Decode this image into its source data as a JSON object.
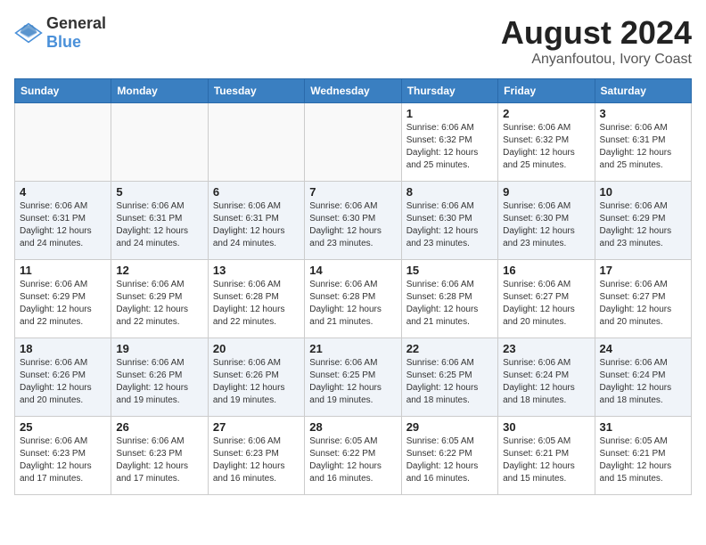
{
  "header": {
    "logo_general": "General",
    "logo_blue": "Blue",
    "title": "August 2024",
    "location": "Anyanfoutou, Ivory Coast"
  },
  "weekdays": [
    "Sunday",
    "Monday",
    "Tuesday",
    "Wednesday",
    "Thursday",
    "Friday",
    "Saturday"
  ],
  "weeks": [
    [
      {
        "day": "",
        "info": ""
      },
      {
        "day": "",
        "info": ""
      },
      {
        "day": "",
        "info": ""
      },
      {
        "day": "",
        "info": ""
      },
      {
        "day": "1",
        "info": "Sunrise: 6:06 AM\nSunset: 6:32 PM\nDaylight: 12 hours\nand 25 minutes."
      },
      {
        "day": "2",
        "info": "Sunrise: 6:06 AM\nSunset: 6:32 PM\nDaylight: 12 hours\nand 25 minutes."
      },
      {
        "day": "3",
        "info": "Sunrise: 6:06 AM\nSunset: 6:31 PM\nDaylight: 12 hours\nand 25 minutes."
      }
    ],
    [
      {
        "day": "4",
        "info": "Sunrise: 6:06 AM\nSunset: 6:31 PM\nDaylight: 12 hours\nand 24 minutes."
      },
      {
        "day": "5",
        "info": "Sunrise: 6:06 AM\nSunset: 6:31 PM\nDaylight: 12 hours\nand 24 minutes."
      },
      {
        "day": "6",
        "info": "Sunrise: 6:06 AM\nSunset: 6:31 PM\nDaylight: 12 hours\nand 24 minutes."
      },
      {
        "day": "7",
        "info": "Sunrise: 6:06 AM\nSunset: 6:30 PM\nDaylight: 12 hours\nand 23 minutes."
      },
      {
        "day": "8",
        "info": "Sunrise: 6:06 AM\nSunset: 6:30 PM\nDaylight: 12 hours\nand 23 minutes."
      },
      {
        "day": "9",
        "info": "Sunrise: 6:06 AM\nSunset: 6:30 PM\nDaylight: 12 hours\nand 23 minutes."
      },
      {
        "day": "10",
        "info": "Sunrise: 6:06 AM\nSunset: 6:29 PM\nDaylight: 12 hours\nand 23 minutes."
      }
    ],
    [
      {
        "day": "11",
        "info": "Sunrise: 6:06 AM\nSunset: 6:29 PM\nDaylight: 12 hours\nand 22 minutes."
      },
      {
        "day": "12",
        "info": "Sunrise: 6:06 AM\nSunset: 6:29 PM\nDaylight: 12 hours\nand 22 minutes."
      },
      {
        "day": "13",
        "info": "Sunrise: 6:06 AM\nSunset: 6:28 PM\nDaylight: 12 hours\nand 22 minutes."
      },
      {
        "day": "14",
        "info": "Sunrise: 6:06 AM\nSunset: 6:28 PM\nDaylight: 12 hours\nand 21 minutes."
      },
      {
        "day": "15",
        "info": "Sunrise: 6:06 AM\nSunset: 6:28 PM\nDaylight: 12 hours\nand 21 minutes."
      },
      {
        "day": "16",
        "info": "Sunrise: 6:06 AM\nSunset: 6:27 PM\nDaylight: 12 hours\nand 20 minutes."
      },
      {
        "day": "17",
        "info": "Sunrise: 6:06 AM\nSunset: 6:27 PM\nDaylight: 12 hours\nand 20 minutes."
      }
    ],
    [
      {
        "day": "18",
        "info": "Sunrise: 6:06 AM\nSunset: 6:26 PM\nDaylight: 12 hours\nand 20 minutes."
      },
      {
        "day": "19",
        "info": "Sunrise: 6:06 AM\nSunset: 6:26 PM\nDaylight: 12 hours\nand 19 minutes."
      },
      {
        "day": "20",
        "info": "Sunrise: 6:06 AM\nSunset: 6:26 PM\nDaylight: 12 hours\nand 19 minutes."
      },
      {
        "day": "21",
        "info": "Sunrise: 6:06 AM\nSunset: 6:25 PM\nDaylight: 12 hours\nand 19 minutes."
      },
      {
        "day": "22",
        "info": "Sunrise: 6:06 AM\nSunset: 6:25 PM\nDaylight: 12 hours\nand 18 minutes."
      },
      {
        "day": "23",
        "info": "Sunrise: 6:06 AM\nSunset: 6:24 PM\nDaylight: 12 hours\nand 18 minutes."
      },
      {
        "day": "24",
        "info": "Sunrise: 6:06 AM\nSunset: 6:24 PM\nDaylight: 12 hours\nand 18 minutes."
      }
    ],
    [
      {
        "day": "25",
        "info": "Sunrise: 6:06 AM\nSunset: 6:23 PM\nDaylight: 12 hours\nand 17 minutes."
      },
      {
        "day": "26",
        "info": "Sunrise: 6:06 AM\nSunset: 6:23 PM\nDaylight: 12 hours\nand 17 minutes."
      },
      {
        "day": "27",
        "info": "Sunrise: 6:06 AM\nSunset: 6:23 PM\nDaylight: 12 hours\nand 16 minutes."
      },
      {
        "day": "28",
        "info": "Sunrise: 6:05 AM\nSunset: 6:22 PM\nDaylight: 12 hours\nand 16 minutes."
      },
      {
        "day": "29",
        "info": "Sunrise: 6:05 AM\nSunset: 6:22 PM\nDaylight: 12 hours\nand 16 minutes."
      },
      {
        "day": "30",
        "info": "Sunrise: 6:05 AM\nSunset: 6:21 PM\nDaylight: 12 hours\nand 15 minutes."
      },
      {
        "day": "31",
        "info": "Sunrise: 6:05 AM\nSunset: 6:21 PM\nDaylight: 12 hours\nand 15 minutes."
      }
    ]
  ]
}
